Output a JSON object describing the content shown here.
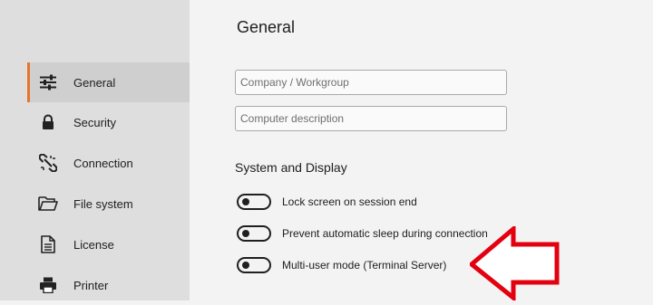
{
  "sidebar": {
    "items": [
      {
        "label": "General",
        "icon": "sliders-icon",
        "active": true
      },
      {
        "label": "Security",
        "icon": "lock-icon"
      },
      {
        "label": "Connection",
        "icon": "broken-link-icon"
      },
      {
        "label": "File system",
        "icon": "folder-icon"
      },
      {
        "label": "License",
        "icon": "document-icon"
      },
      {
        "label": "Printer",
        "icon": "printer-icon"
      }
    ]
  },
  "main": {
    "title": "General",
    "company": {
      "placeholder": "Company / Workgroup",
      "value": ""
    },
    "description": {
      "placeholder": "Computer description",
      "value": ""
    },
    "section_title": "System and Display",
    "toggles": [
      {
        "label": "Lock screen on session end",
        "on": false
      },
      {
        "label": "Prevent automatic sleep during connection",
        "on": false
      },
      {
        "label": "Multi-user mode (Terminal Server)",
        "on": false
      }
    ]
  },
  "colors": {
    "accent": "#e8742a",
    "arrow": "#e3000f"
  }
}
